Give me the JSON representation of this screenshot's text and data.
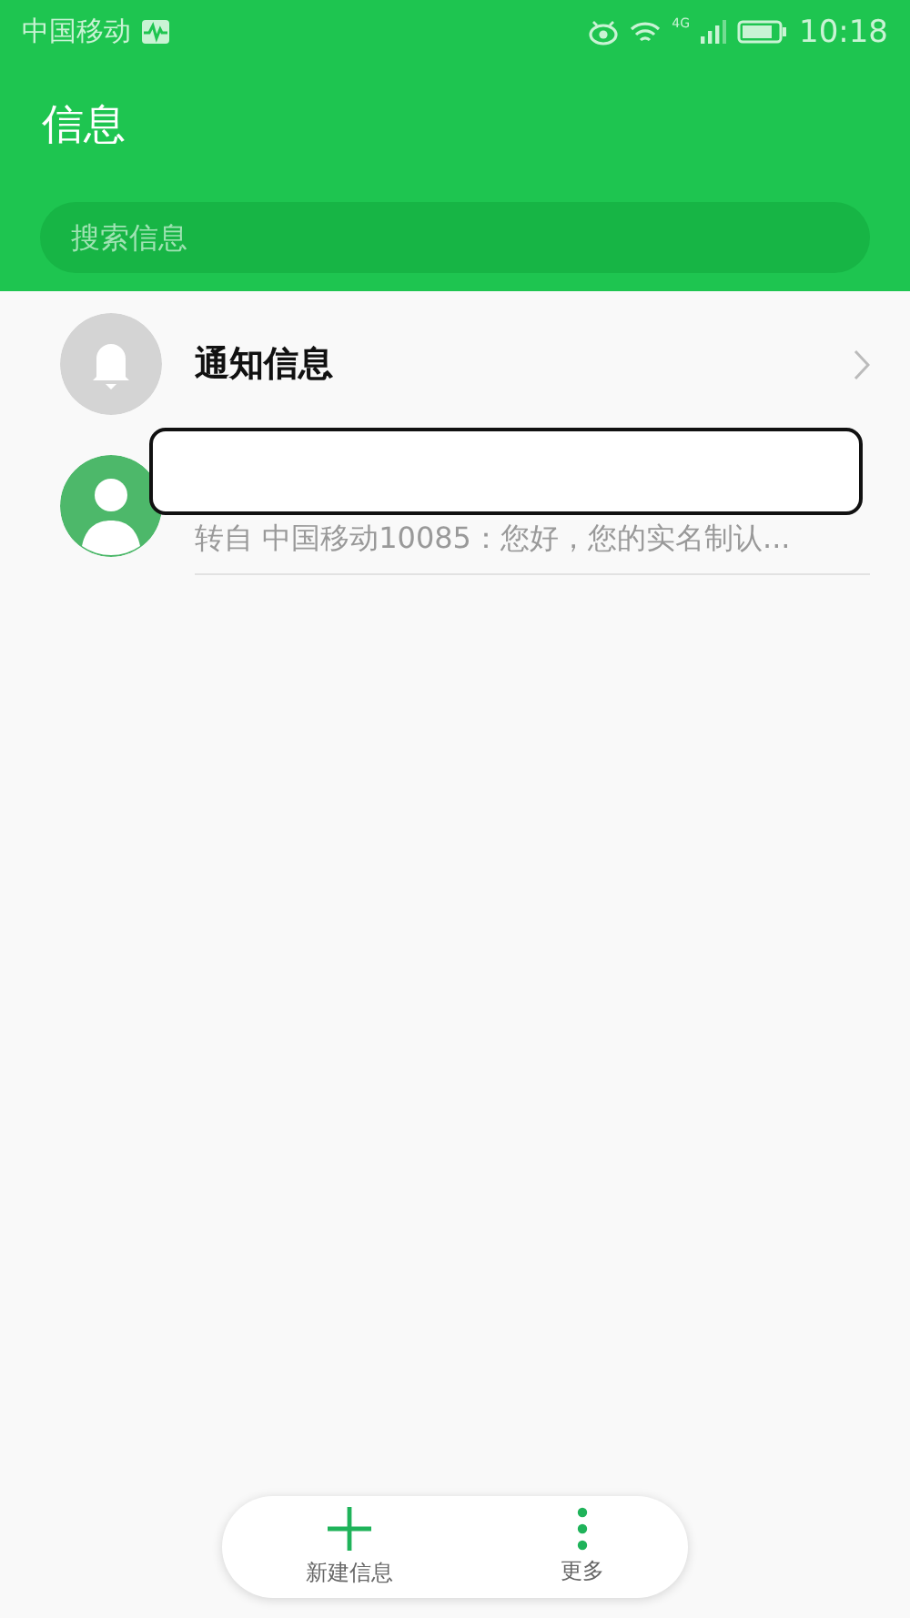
{
  "status_bar": {
    "carrier": "中国移动",
    "network": "4G",
    "time": "10:18"
  },
  "header": {
    "title": "信息"
  },
  "search": {
    "placeholder": "搜索信息"
  },
  "conversations": [
    {
      "kind": "notice",
      "title": "通知信息"
    },
    {
      "kind": "contact",
      "preview": "转自 中国移动10085：您好，您的实名制认...",
      "redacted": true
    }
  ],
  "bottom_bar": [
    {
      "kind": "add",
      "label": "新建信息"
    },
    {
      "kind": "more",
      "label": "更多"
    }
  ]
}
